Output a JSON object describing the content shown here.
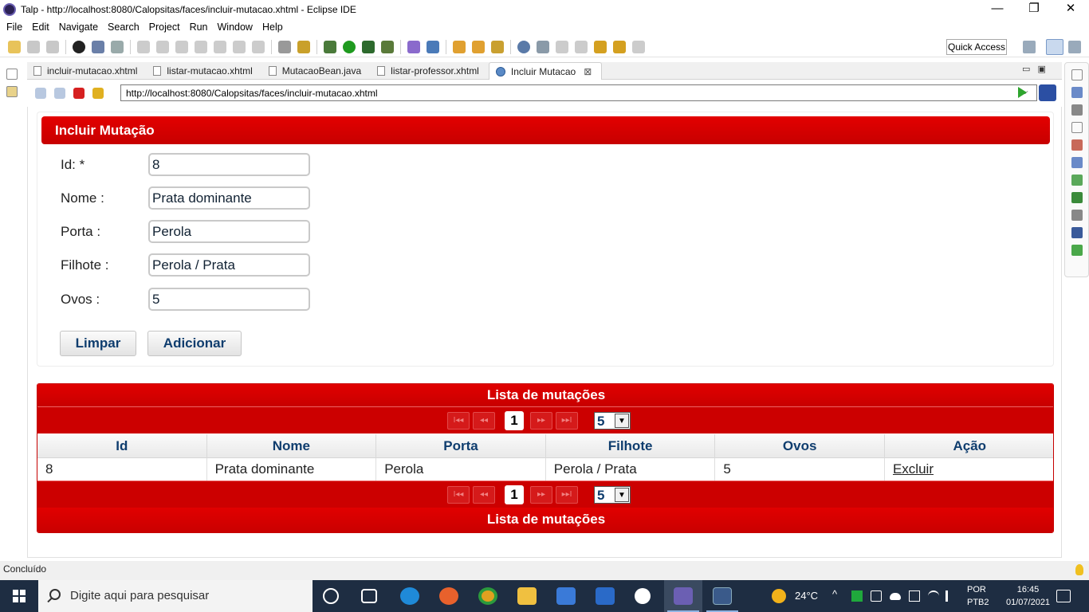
{
  "window": {
    "title": "Talp - http://localhost:8080/Calopsitas/faces/incluir-mutacao.xhtml - Eclipse IDE",
    "minimize": "—",
    "restore": "❐",
    "close": "✕"
  },
  "menu": [
    "File",
    "Edit",
    "Navigate",
    "Search",
    "Project",
    "Run",
    "Window",
    "Help"
  ],
  "quick_access": "Quick Access",
  "editor_tabs": [
    {
      "label": "incluir-mutacao.xhtml",
      "icon": "file-icon"
    },
    {
      "label": "listar-mutacao.xhtml",
      "icon": "file-icon"
    },
    {
      "label": "MutacaoBean.java",
      "icon": "java-file-icon"
    },
    {
      "label": "listar-professor.xhtml",
      "icon": "file-icon"
    },
    {
      "label": "Incluir Mutacao",
      "icon": "globe-icon",
      "close": "⊠"
    }
  ],
  "browser": {
    "url": "http://localhost:8080/Calopsitas/faces/incluir-mutacao.xhtml"
  },
  "form": {
    "header": "Incluir Mutação",
    "fields": [
      {
        "label": "Id: *",
        "value": "8"
      },
      {
        "label": "Nome :",
        "value": "Prata dominante"
      },
      {
        "label": "Porta :",
        "value": "Perola"
      },
      {
        "label": "Filhote :",
        "value": "Perola / Prata"
      },
      {
        "label": "Ovos :",
        "value": "5"
      }
    ],
    "clear_button": "Limpar",
    "add_button": "Adicionar"
  },
  "table": {
    "caption": "Lista de mutações",
    "footer_caption": "Lista de mutações",
    "pager": {
      "first": "I◂◂",
      "prev": "◂◂",
      "current_page": "1",
      "next": "▸▸",
      "last": "▸▸I",
      "rows_per_page": "5"
    },
    "columns": [
      "Id",
      "Nome",
      "Porta",
      "Filhote",
      "Ovos",
      "Ação"
    ],
    "rows": [
      [
        "8",
        "Prata dominante",
        "Perola",
        "Perola / Prata",
        "5",
        "Excluir"
      ]
    ]
  },
  "status": "Concluído",
  "taskbar": {
    "search_placeholder": "Digite aqui para pesquisar",
    "temperature": "24°C",
    "language": "POR",
    "keyboard": "PTB2",
    "time": "16:45",
    "date": "01/07/2021"
  },
  "colors": {
    "header_red": "#cc0000",
    "text_navy": "#0f3d6e",
    "taskbar_bg": "#1e2d42"
  }
}
